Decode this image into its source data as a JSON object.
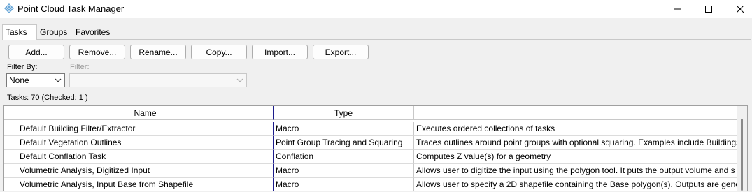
{
  "window": {
    "title": "Point Cloud Task Manager"
  },
  "tabs": [
    "Tasks",
    "Groups",
    "Favorites"
  ],
  "toolbar": {
    "add": "Add...",
    "remove": "Remove...",
    "rename": "Rename...",
    "copy": "Copy...",
    "import": "Import...",
    "export": "Export..."
  },
  "filter": {
    "by_label": "Filter By:",
    "by_value": "None",
    "filter_label": "Filter:",
    "filter_value": ""
  },
  "status": {
    "tasks_count": "Tasks: 70 (Checked: 1 )"
  },
  "table": {
    "columns": [
      "Name",
      "Type",
      ""
    ],
    "rows": [
      {
        "name": "Default Building Filter/Extractor",
        "type": "Macro",
        "desc": "Executes ordered collections of tasks"
      },
      {
        "name": "Default Vegetation Outlines",
        "type": "Point Group Tracing and Squaring",
        "desc": "Traces outlines around point groups with optional squaring. Examples include Buildings"
      },
      {
        "name": "Default Conflation Task",
        "type": "Conflation",
        "desc": "Computes Z value(s) for a geometry"
      },
      {
        "name": "Volumetric Analysis, Digitized Input",
        "type": "Macro",
        "desc": "Allows user to digitize the input using the polygon tool.  It puts the output volume and s"
      },
      {
        "name": "Volumetric Analysis, Input Base from Shapefile",
        "type": "Macro",
        "desc": "Allows user to specify a 2D shapefile containing the Base polygon(s).  Outputs are gener"
      }
    ]
  },
  "icons": {
    "app": "point-cloud-icon",
    "minimize": "minimize-icon",
    "maximize": "maximize-icon",
    "close": "close-icon"
  },
  "colors": {
    "type_column_border": "#1c1c8c"
  }
}
